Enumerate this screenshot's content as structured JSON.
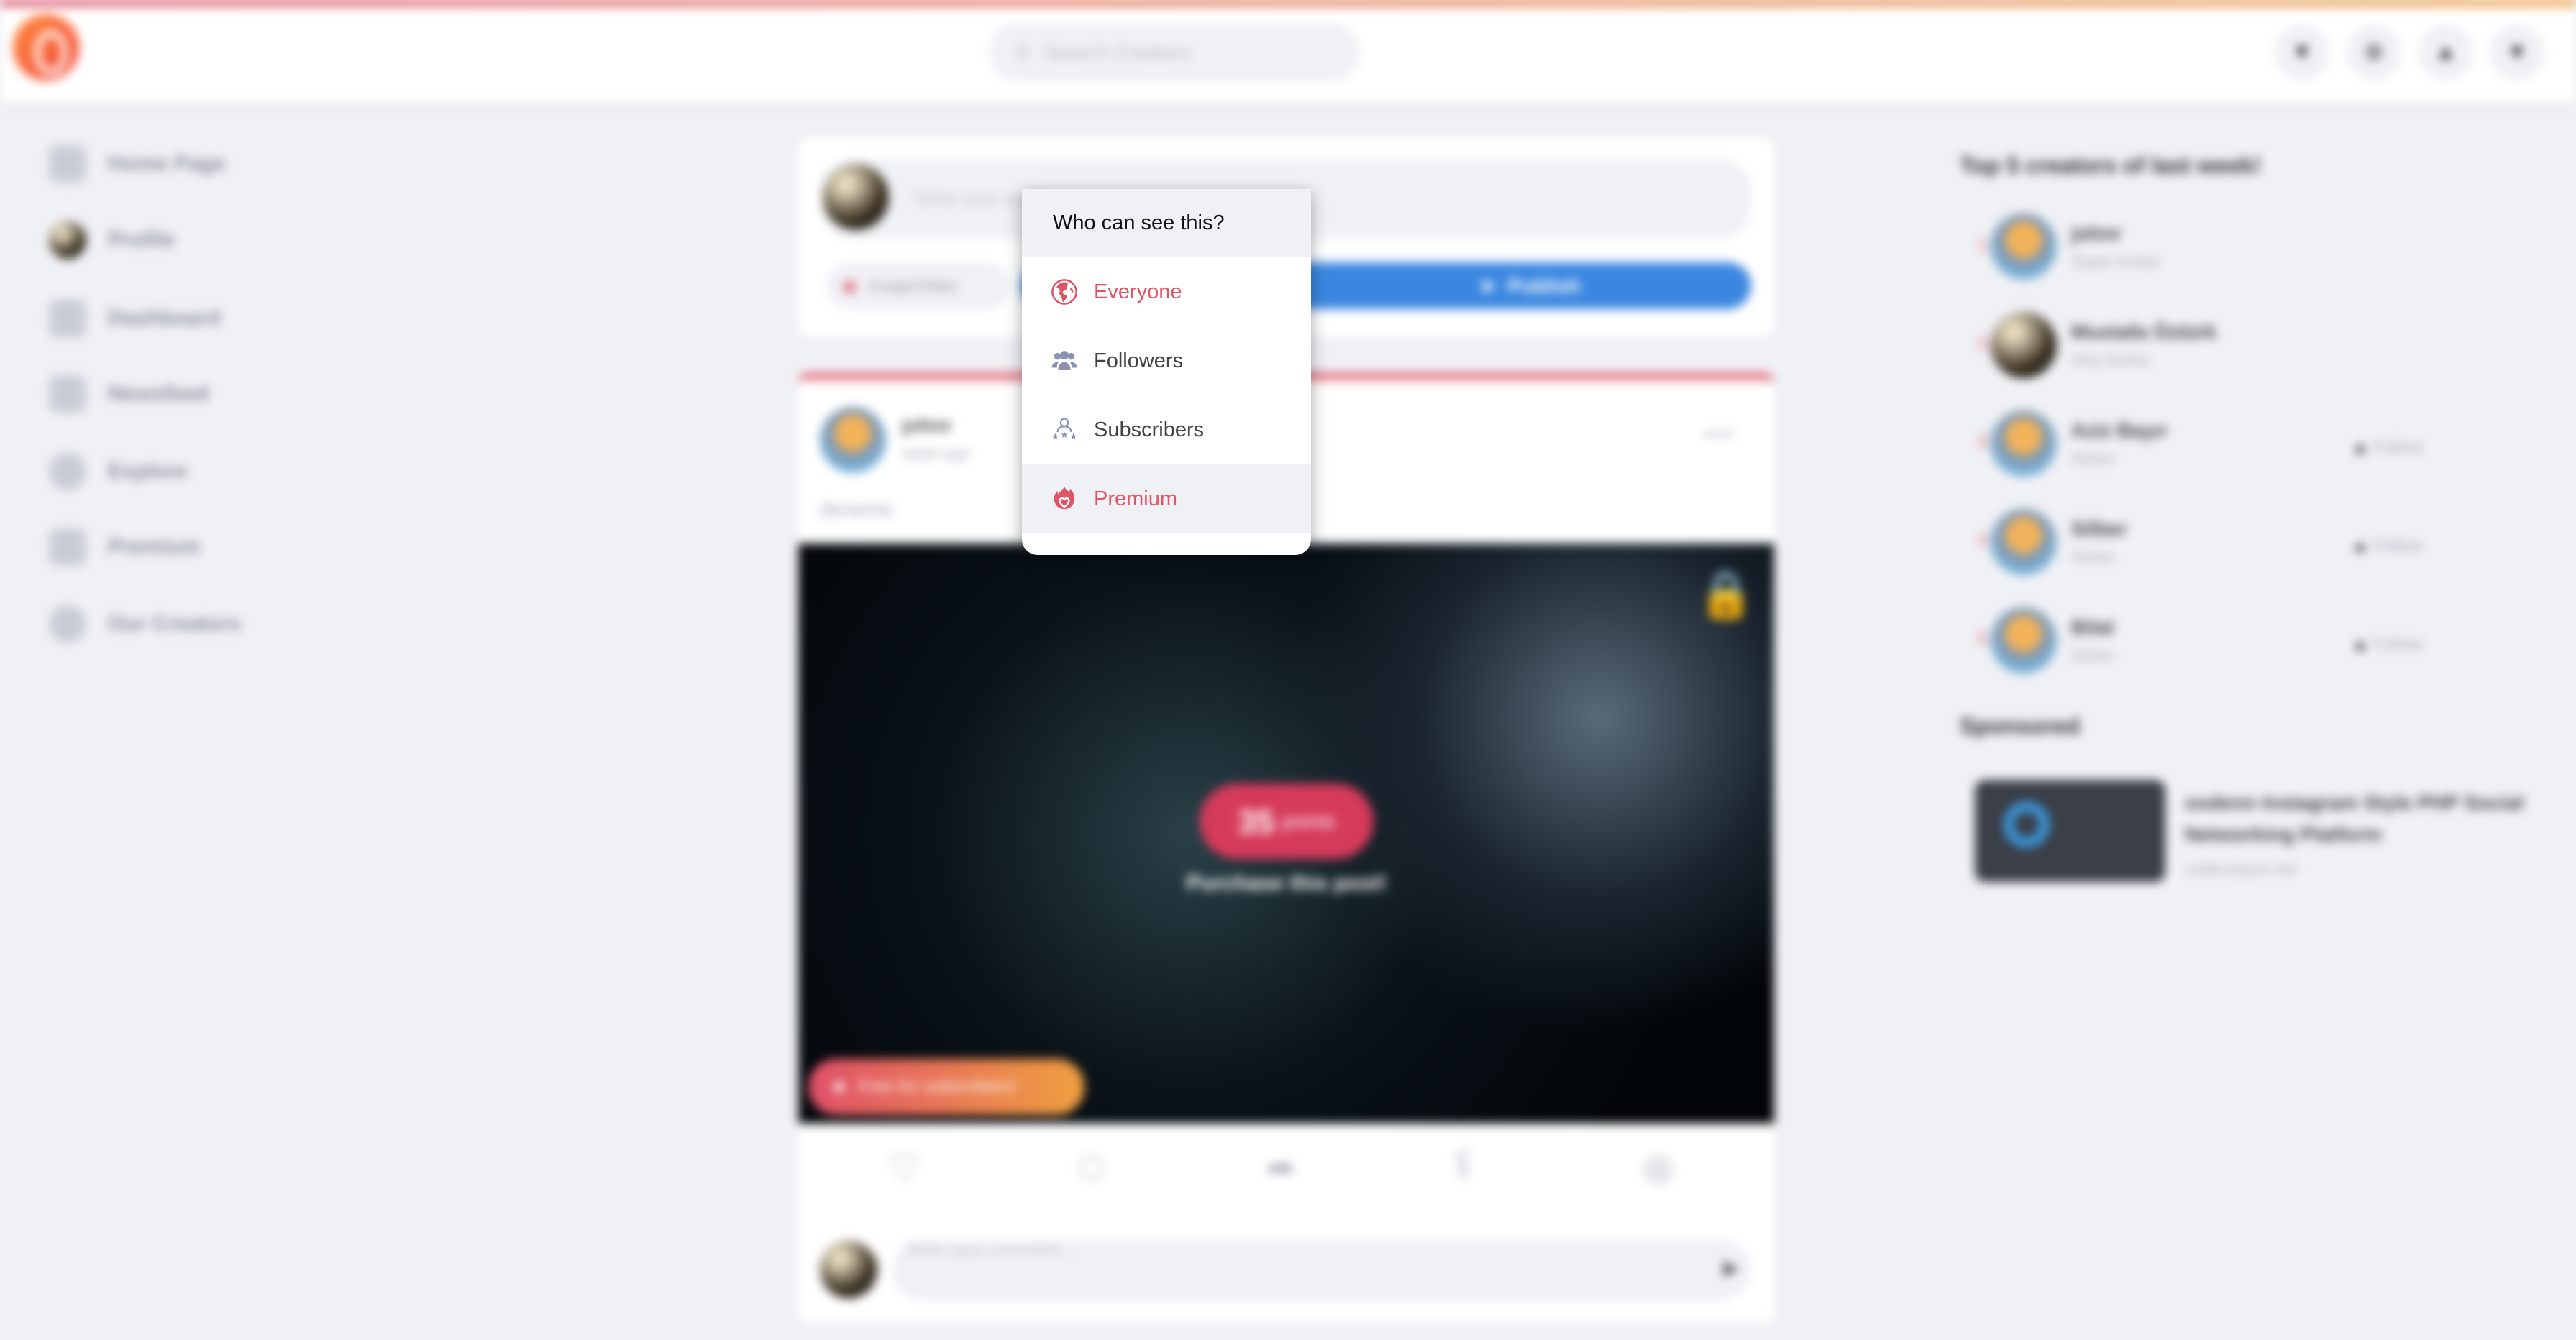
{
  "header": {
    "search_placeholder": "Search Creators",
    "icons": [
      "diamond-icon",
      "settings-icon",
      "bell-icon",
      "chevron-down-icon"
    ]
  },
  "sidebar": {
    "items": [
      {
        "label": "Home Page"
      },
      {
        "label": "Profile"
      },
      {
        "label": "Dashboard"
      },
      {
        "label": "Newsfeed"
      },
      {
        "label": "Explore"
      },
      {
        "label": "Premium"
      },
      {
        "label": "Our Creators"
      }
    ]
  },
  "composer": {
    "placeholder": "Write your post...",
    "image_video_label": "Image/Video",
    "publish_label": "Publish"
  },
  "post": {
    "author": "johnr",
    "time": "week ago",
    "caption": "deneme",
    "points": "35",
    "points_unit": "points",
    "purchase_label": "Purchase this post!",
    "free_label": "Free for subscribers!",
    "comment_placeholder": "Write your comment..."
  },
  "visibility_menu": {
    "title": "Who can see this?",
    "options": [
      {
        "label": "Everyone",
        "icon": "globe-icon"
      },
      {
        "label": "Followers",
        "icon": "users-icon"
      },
      {
        "label": "Subscribers",
        "icon": "subscribers-icon"
      },
      {
        "label": "Premium",
        "icon": "flame-heart-icon"
      }
    ],
    "selected": "Everyone",
    "highlighted": "Premium"
  },
  "right": {
    "title": "Top 5 creators of last week!",
    "creators": [
      {
        "rank": "1",
        "name": "johnr",
        "status": "Super Active",
        "follow": ""
      },
      {
        "rank": "2",
        "name": "Mustafa Öztürk",
        "status": "Very Active",
        "follow": ""
      },
      {
        "rank": "3",
        "name": "Aziz Bayır",
        "status": "Active",
        "follow": "Follow"
      },
      {
        "rank": "4",
        "name": "Silber",
        "status": "Active",
        "follow": "Follow"
      },
      {
        "rank": "5",
        "name": "Bilal",
        "status": "Active",
        "follow": "Follow"
      }
    ],
    "sponsored_title": "Sponsored",
    "ad": {
      "title": "oxdenn Instagram Style PHP Social Networking Platform",
      "domain": "codecanyon.net"
    }
  },
  "colors": {
    "accent": "#e05565",
    "blue": "#3b87e0",
    "bg": "#f0f1f5"
  }
}
